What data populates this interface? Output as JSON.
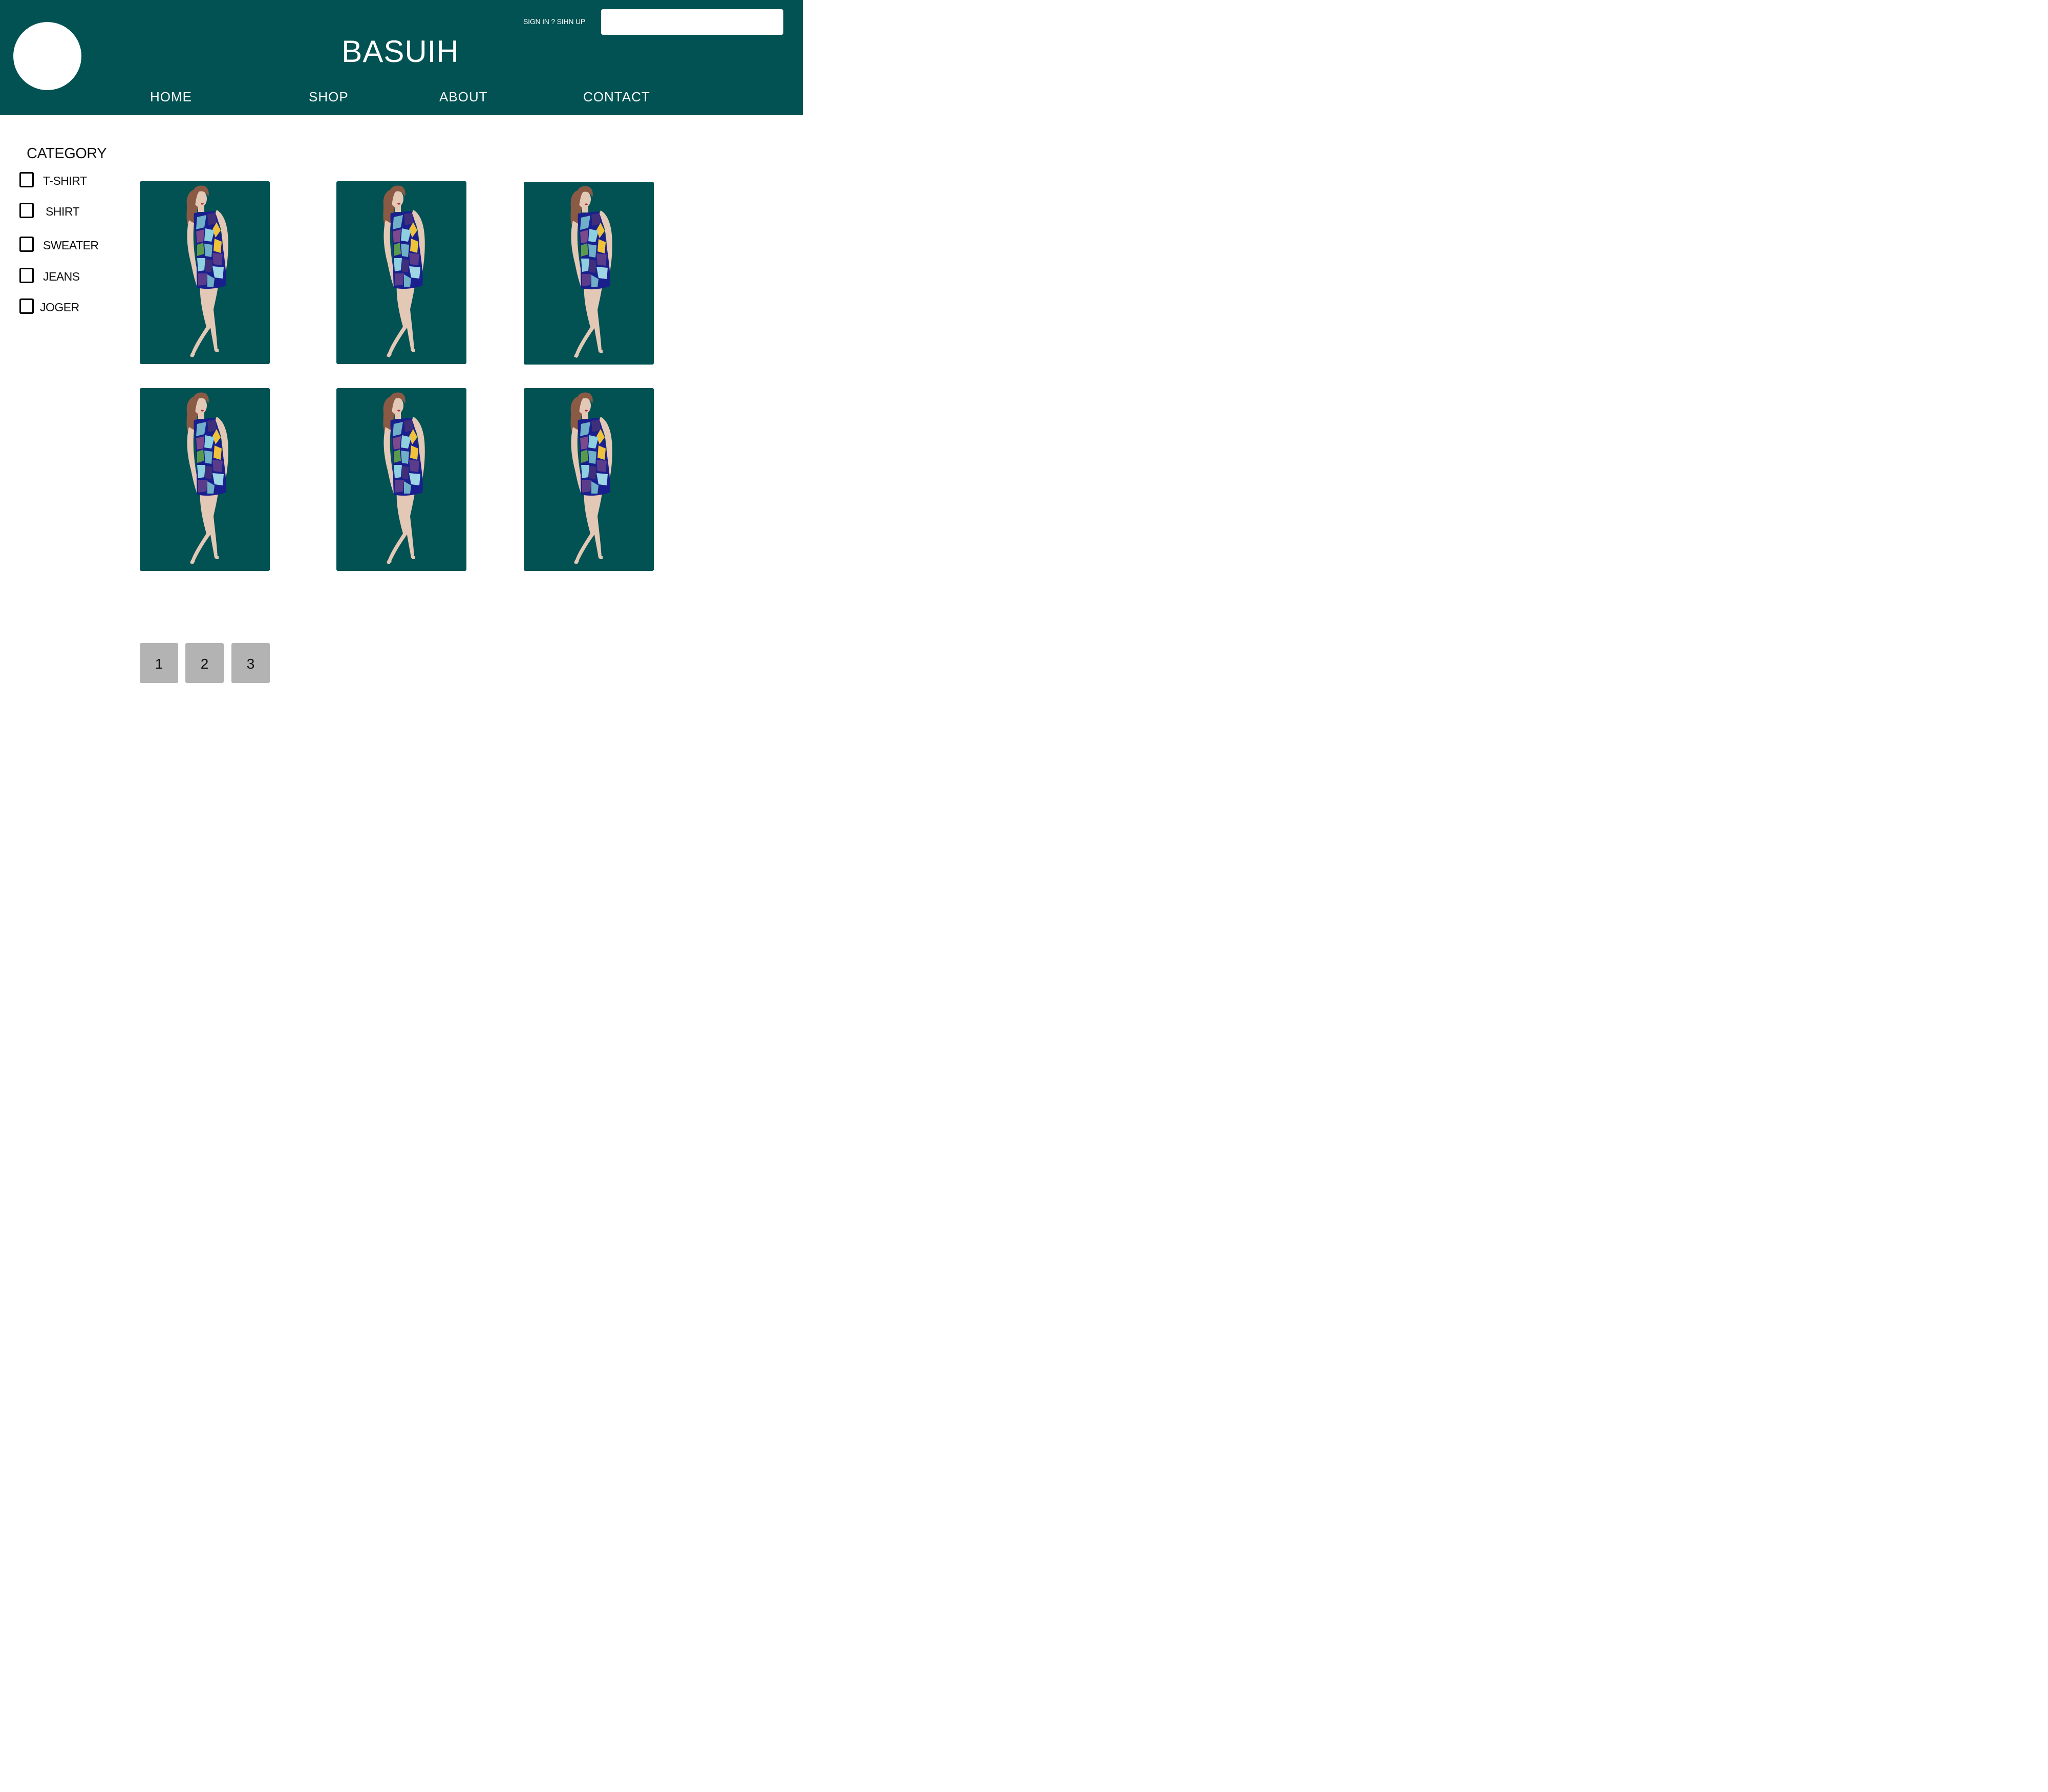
{
  "header": {
    "brand": "BASUIH",
    "auth_link": "SIGN IN ? SIHN UP",
    "search": {
      "value": "",
      "placeholder": ""
    },
    "nav": [
      "HOME",
      "SHOP",
      "ABOUT",
      "CONTACT"
    ]
  },
  "sidebar": {
    "title": "CATEGORY",
    "items": [
      {
        "label": "T-SHIRT",
        "checked": false
      },
      {
        "label": "SHIRT",
        "checked": false
      },
      {
        "label": "SWEATER",
        "checked": false
      },
      {
        "label": "JEANS",
        "checked": false
      },
      {
        "label": "JOGER",
        "checked": false
      }
    ]
  },
  "products": [
    {
      "image": "woman-in-patterned-dress"
    },
    {
      "image": "woman-in-patterned-dress"
    },
    {
      "image": "woman-in-patterned-dress"
    },
    {
      "image": "woman-in-patterned-dress"
    },
    {
      "image": "woman-in-patterned-dress"
    },
    {
      "image": "woman-in-patterned-dress"
    }
  ],
  "pagination": [
    "1",
    "2",
    "3"
  ],
  "colors": {
    "brand": "#025253",
    "page_button": "#b3b3b3",
    "background": "#ffffff"
  }
}
